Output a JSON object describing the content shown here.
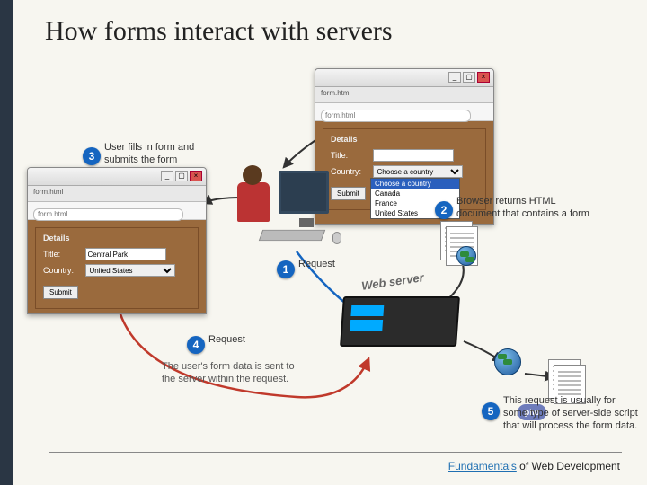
{
  "title": "How forms interact with servers",
  "footer": {
    "fundamentals": "Fundamentals",
    "rest": " of Web Development"
  },
  "browser": {
    "tab": "form.html",
    "url_placeholder": "form.html",
    "legend": "Details",
    "title_label": "Title:",
    "country_label": "Country:",
    "submit": "Submit"
  },
  "windowA": {
    "title_value": "Central Park",
    "country_value": "United States"
  },
  "windowB": {
    "title_value": "",
    "select_placeholder": "Choose a country",
    "options": [
      "Choose a country",
      "Canada",
      "France",
      "United States"
    ]
  },
  "server_label": "Web server",
  "php_label": "php",
  "steps": {
    "s1": {
      "n": "1",
      "label": "Request"
    },
    "s2": {
      "n": "2",
      "label": "Browser returns HTML document that contains a form"
    },
    "s3": {
      "n": "3",
      "label": "User fills in form and submits the form"
    },
    "s4": {
      "n": "4",
      "label": "Request",
      "detail": "The user's form data is sent to the server within the request."
    },
    "s5": {
      "n": "5",
      "label": "This request is usually for some type of server-side script that will process the form data."
    }
  }
}
